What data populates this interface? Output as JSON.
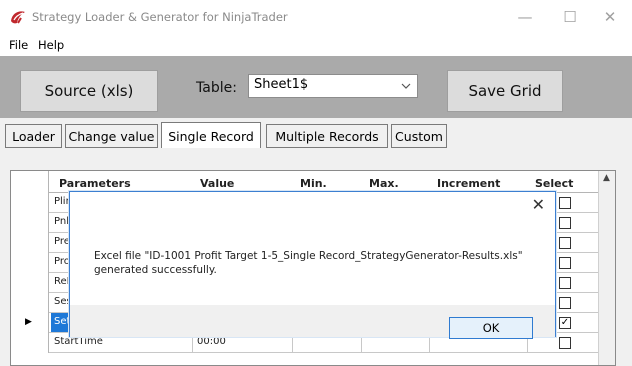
{
  "window": {
    "title": "Strategy Loader & Generator for NinjaTrader",
    "minimize_icon": "—",
    "maximize_icon": "☐",
    "close_icon": "✕"
  },
  "menu": {
    "items": [
      "File",
      "Help"
    ]
  },
  "toolbar": {
    "source_label": "Source (xls)",
    "table_label": "Table:",
    "table_value": "Sheet1$",
    "save_label": "Save Grid"
  },
  "tabs": [
    {
      "label": "Loader",
      "active": false
    },
    {
      "label": "Change value",
      "active": false
    },
    {
      "label": "Single Record",
      "active": true
    },
    {
      "label": "Multiple Records",
      "active": false
    },
    {
      "label": "Custom",
      "active": false
    }
  ],
  "grid": {
    "headers": [
      "Parameters",
      "Value",
      "Min.",
      "Max.",
      "Increment",
      "Select"
    ],
    "rows": [
      {
        "param": "Plinfo",
        "value": "",
        "checked": false,
        "current": false,
        "selected": false
      },
      {
        "param": "Pnlco",
        "value": "",
        "checked": false,
        "current": false,
        "selected": false
      },
      {
        "param": "Previ",
        "value": "",
        "checked": false,
        "current": false,
        "selected": false
      },
      {
        "param": "Profi",
        "value": "",
        "checked": false,
        "current": false,
        "selected": false
      },
      {
        "param": "ReEn",
        "value": "",
        "checked": false,
        "current": false,
        "selected": false
      },
      {
        "param": "Sessi",
        "value": "",
        "checked": false,
        "current": false,
        "selected": false
      },
      {
        "param": "SetPr",
        "value": "",
        "checked": true,
        "current": true,
        "selected": true
      },
      {
        "param": "StartTime",
        "value": "00:00",
        "checked": false,
        "current": false,
        "selected": false
      }
    ],
    "current_row_marker": "▶",
    "scroll_up_icon": "▲"
  },
  "dialog": {
    "message": "Excel file \"ID-1001 Profit Target 1-5_Single Record_StrategyGenerator-Results.xls\" generated successfully.",
    "ok_label": "OK",
    "close_icon": "✕"
  }
}
